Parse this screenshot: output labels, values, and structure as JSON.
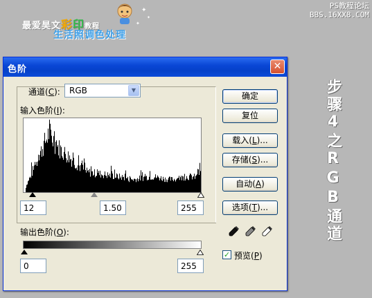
{
  "banner": {
    "brand_prefix": "最爱昊文",
    "brand_hl1": "彩",
    "brand_hl2": "印",
    "brand_suffix": "教程",
    "subtitle": "生活照调色处理",
    "site_line1": "PS教程论坛",
    "site_line2": "BBS.16XX8.COM"
  },
  "side_caption": "步骤4之RGB通道",
  "dialog": {
    "title": "色阶",
    "channel_label_pre": "通道(",
    "channel_label_key": "C",
    "channel_label_post": "):",
    "channel_value": "RGB",
    "input_label_pre": "输入色阶(",
    "input_label_key": "I",
    "input_label_post": "):",
    "input_black": "12",
    "input_gamma": "1.50",
    "input_white": "255",
    "output_label_pre": "输出色阶(",
    "output_label_key": "O",
    "output_label_post": "):",
    "output_black": "0",
    "output_white": "255",
    "buttons": {
      "ok": "确定",
      "reset": "复位",
      "load_pre": "载入(",
      "load_key": "L",
      "load_post": ")...",
      "save_pre": "存储(",
      "save_key": "S",
      "save_post": ")...",
      "auto_pre": "自动(",
      "auto_key": "A",
      "auto_post": ")",
      "options_pre": "选项(",
      "options_key": "T",
      "options_post": ")..."
    },
    "preview_pre": "预览(",
    "preview_key": "P",
    "preview_post": ")",
    "preview_checked": true
  },
  "colors": {
    "titlebar": "#0a47d6",
    "dialog_bg": "#ece9d8",
    "page_bg": "#b7b7b7",
    "close": "#d5512f"
  }
}
